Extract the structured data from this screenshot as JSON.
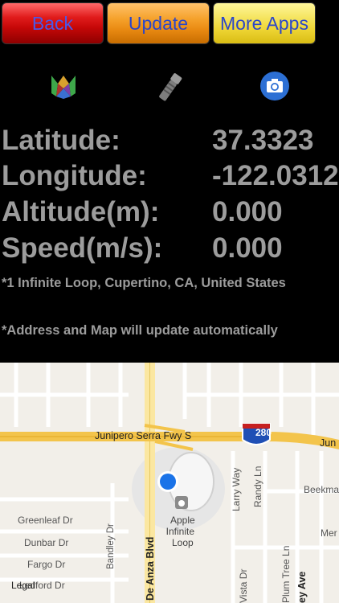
{
  "toolbar": {
    "back_label": "Back",
    "update_label": "Update",
    "more_apps_label": "More Apps"
  },
  "icons": [
    "app-logo-icon",
    "flashlight-icon",
    "camera-icon"
  ],
  "readings": {
    "latitude_label": "Latitude:",
    "latitude_value": "37.3323",
    "longitude_label": "Longitude:",
    "longitude_value": "-122.0312",
    "altitude_label": "Altitude(m):",
    "altitude_value": "0.000",
    "speed_label": "Speed(m/s):",
    "speed_value": "0.000"
  },
  "address": "*1 Infinite Loop, Cupertino, CA, United States",
  "auto_update_note": "*Address and Map will update automatically",
  "map": {
    "highway_label": "Junipero Serra Fwy S",
    "highway_shield": "280",
    "junction_label": "Jun",
    "poi_line1": "Apple",
    "poi_line2": "Infinite",
    "poi_line3": "Loop",
    "streets": {
      "de_anza": "De Anza Blvd",
      "larry": "Larry Way",
      "randy": "Randy Ln",
      "beekman": "Beekman",
      "greenleaf": "Greenleaf Dr",
      "dunbar": "Dunbar Dr",
      "fargo": "Fargo Dr",
      "ledford": "Ledford Dr",
      "bandley": "Bandley Dr",
      "vista": "Vista Dr",
      "plum_tree": "Plum Tree Ln",
      "mer": "Mer",
      "ey_ave": "ey Ave"
    },
    "legal_label": "Legal"
  },
  "colors": {
    "label_gray": "#9c9c9c",
    "location_dot": "#1a73e8",
    "highway": "#f3c44b"
  }
}
